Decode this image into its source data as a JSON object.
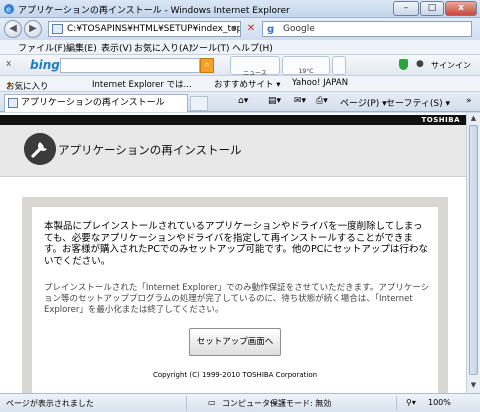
{
  "window": {
    "title": "アプリケーションの再インストール - Windows Internet Explorer",
    "minimize": "–",
    "maximize": "□",
    "close": "x"
  },
  "address_bar": {
    "url": "C:¥TOSAPINS¥HTML¥SETUP¥index_top.ht",
    "refresh_glyph": "↻",
    "stop_glyph": "✕",
    "dropdown_glyph": "▾"
  },
  "search": {
    "provider": "Google",
    "logo_letter": "g",
    "button_glyph": "⌕"
  },
  "menu": [
    "ファイル(F)",
    "編集(E)",
    "表示(V)",
    "お気に入り(A)",
    "ツール(T)",
    "ヘルプ(H)"
  ],
  "bing_bar": {
    "close_glyph": "x",
    "logo": "bing",
    "search_glyph": "⌕",
    "news_label": "ニュース",
    "weather_label": "19°C",
    "signin_label": "サインイン"
  },
  "favorites_bar": {
    "favorites_label": "お気に入り",
    "items": [
      "Internet Explorer では...",
      "おすすめサイト ▾",
      "Yahoo! JAPAN"
    ]
  },
  "tab": {
    "label": "アプリケーションの再インストール"
  },
  "command_bar": {
    "page_menu": "ページ(P) ▾",
    "safety_menu": "セーフティ(S) ▾",
    "more_glyph": "»"
  },
  "page": {
    "brand": "TOSHIBA",
    "title": "アプリケーションの再インストール",
    "message_primary": "本製品にプレインストールされているアプリケーションやドライバを一度削除してしまっても、必要なアプリケーションやドライバを指定して再インストールすることができます。お客様が購入されたPCでのみセットアップ可能です。他のPCにセットアップは行わないでください。",
    "message_secondary": "プレインストールされた「Internet Explorer」でのみ動作保証をさせていただきます。アプリケーション等のセットアッププログラムの処理が完了しているのに、待ち状態が続く場合は、「Internet Explorer」を最小化または終了してください。",
    "setup_button": "セットアップ画面へ",
    "copyright": "Copyright (C) 1999-2010 TOSHIBA Corporation"
  },
  "status_bar": {
    "status_text": "ページが表示されました",
    "zone": "コンピューター",
    "protected_mode": "保護モード: 無効",
    "zoom": "100%"
  }
}
